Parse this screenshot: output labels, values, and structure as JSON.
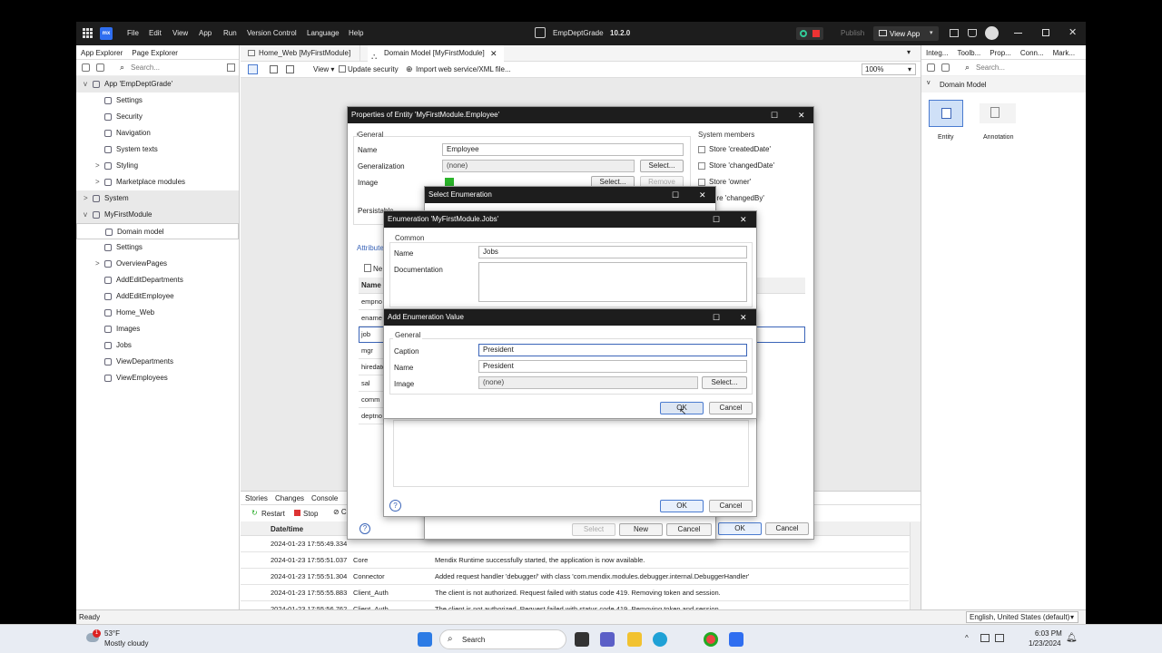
{
  "titlebar": {
    "menu": [
      "File",
      "Edit",
      "View",
      "App",
      "Run",
      "Version Control",
      "Language",
      "Help"
    ],
    "project": "EmpDeptGrade",
    "version": "10.2.0",
    "publish": "Publish",
    "view_app": "View App",
    "logo": "mx"
  },
  "left_panel": {
    "tabs": [
      "App Explorer",
      "Page Explorer"
    ],
    "search_placeholder": "Search...",
    "tree": [
      {
        "label": "App 'EmpDeptGrade'",
        "indent": 0,
        "chevron": "v"
      },
      {
        "label": "Settings",
        "indent": 1,
        "chevron": ""
      },
      {
        "label": "Security",
        "indent": 1,
        "chevron": ""
      },
      {
        "label": "Navigation",
        "indent": 1,
        "chevron": ""
      },
      {
        "label": "System texts",
        "indent": 1,
        "chevron": ""
      },
      {
        "label": "Styling",
        "indent": 1,
        "chevron": ">"
      },
      {
        "label": "Marketplace modules",
        "indent": 1,
        "chevron": ">"
      },
      {
        "label": "System",
        "indent": 0,
        "chevron": ">"
      },
      {
        "label": "MyFirstModule",
        "indent": 0,
        "chevron": "v"
      },
      {
        "label": "Domain model",
        "indent": 1,
        "chevron": ""
      },
      {
        "label": "Settings",
        "indent": 1,
        "chevron": ""
      },
      {
        "label": "OverviewPages",
        "indent": 1,
        "chevron": ">"
      },
      {
        "label": "AddEditDepartments",
        "indent": 1,
        "chevron": ""
      },
      {
        "label": "AddEditEmployee",
        "indent": 1,
        "chevron": ""
      },
      {
        "label": "Home_Web",
        "indent": 1,
        "chevron": ""
      },
      {
        "label": "Images",
        "indent": 1,
        "chevron": ""
      },
      {
        "label": "Jobs",
        "indent": 1,
        "chevron": ""
      },
      {
        "label": "ViewDepartments",
        "indent": 1,
        "chevron": ""
      },
      {
        "label": "ViewEmployees",
        "indent": 1,
        "chevron": ""
      }
    ]
  },
  "doc_tabs": [
    "Home_Web [MyFirstModule]",
    "Domain Model [MyFirstModule]"
  ],
  "toolbar": {
    "view": "View",
    "update_security": "Update security",
    "import": "Import web service/XML file...",
    "zoom": "100%"
  },
  "right_panel": {
    "tabs": [
      "Integ...",
      "Toolb...",
      "Prop...",
      "Conn...",
      "Mark..."
    ],
    "search_placeholder": "Search...",
    "section": "Domain Model",
    "items": [
      "Entity",
      "Annotation"
    ]
  },
  "entity_dialog": {
    "title": "Properties of Entity 'MyFirstModule.Employee'",
    "general": "General",
    "name_label": "Name",
    "name_value": "Employee",
    "generalization_label": "Generalization",
    "generalization_value": "(none)",
    "select": "Select...",
    "image_label": "Image",
    "remove": "Remove",
    "persistable_label": "Persistable",
    "system_members": "System members",
    "members": [
      "Store 'createdDate'",
      "Store 'changedDate'",
      "Store 'owner'",
      "ore 'changedBy'"
    ],
    "attributes_tab": "Attribute",
    "new": "Ne",
    "name_col": "Name",
    "attributes": [
      "empno",
      "ename",
      "job",
      "mgr",
      "hiredate",
      "sal",
      "comm",
      "deptno"
    ],
    "ok": "OK",
    "cancel": "Cancel"
  },
  "select_enum_dialog": {
    "title": "Select Enumeration",
    "select": "Select",
    "new": "New",
    "cancel": "Cancel"
  },
  "enum_dialog": {
    "title": "Enumeration 'MyFirstModule.Jobs'",
    "common": "Common",
    "name_label": "Name",
    "name_value": "Jobs",
    "documentation_label": "Documentation",
    "ok": "OK",
    "cancel": "Cancel"
  },
  "add_value_dialog": {
    "title": "Add Enumeration Value",
    "general": "General",
    "caption_label": "Caption",
    "caption_value": "President",
    "name_label": "Name",
    "name_value": "President",
    "image_label": "Image",
    "image_value": "(none)",
    "select": "Select...",
    "ok": "OK",
    "cancel": "Cancel"
  },
  "console": {
    "tabs": [
      "Stories",
      "Changes",
      "Console"
    ],
    "restart": "Restart",
    "stop": "Stop",
    "date_header": "Date/time",
    "rows": [
      {
        "time": "2024-01-23 17:55:49.334",
        "source": "",
        "msg": ""
      },
      {
        "time": "2024-01-23 17:55:51.037",
        "source": "Core",
        "msg": "Mendix Runtime successfully started, the application is now available."
      },
      {
        "time": "2024-01-23 17:55:51.304",
        "source": "Connector",
        "msg": "Added request handler 'debugger/' with class 'com.mendix.modules.debugger.internal.DebuggerHandler'"
      },
      {
        "time": "2024-01-23 17:55:55.883",
        "source": "Client_Auth",
        "msg": "The client is not authorized. Request failed with status code 419. Removing token and session."
      },
      {
        "time": "2024-01-23 17:55:56.762",
        "source": "Client_Auth",
        "msg": "The client is not authorized. Request failed with status code 419. Removing token and session."
      }
    ]
  },
  "status": {
    "ready": "Ready",
    "locale": "English, United States (default)"
  },
  "taskbar": {
    "temp": "53°F",
    "weather": "Mostly cloudy",
    "search": "Search",
    "time": "6:03 PM",
    "date": "1/23/2024",
    "badge": "1"
  }
}
